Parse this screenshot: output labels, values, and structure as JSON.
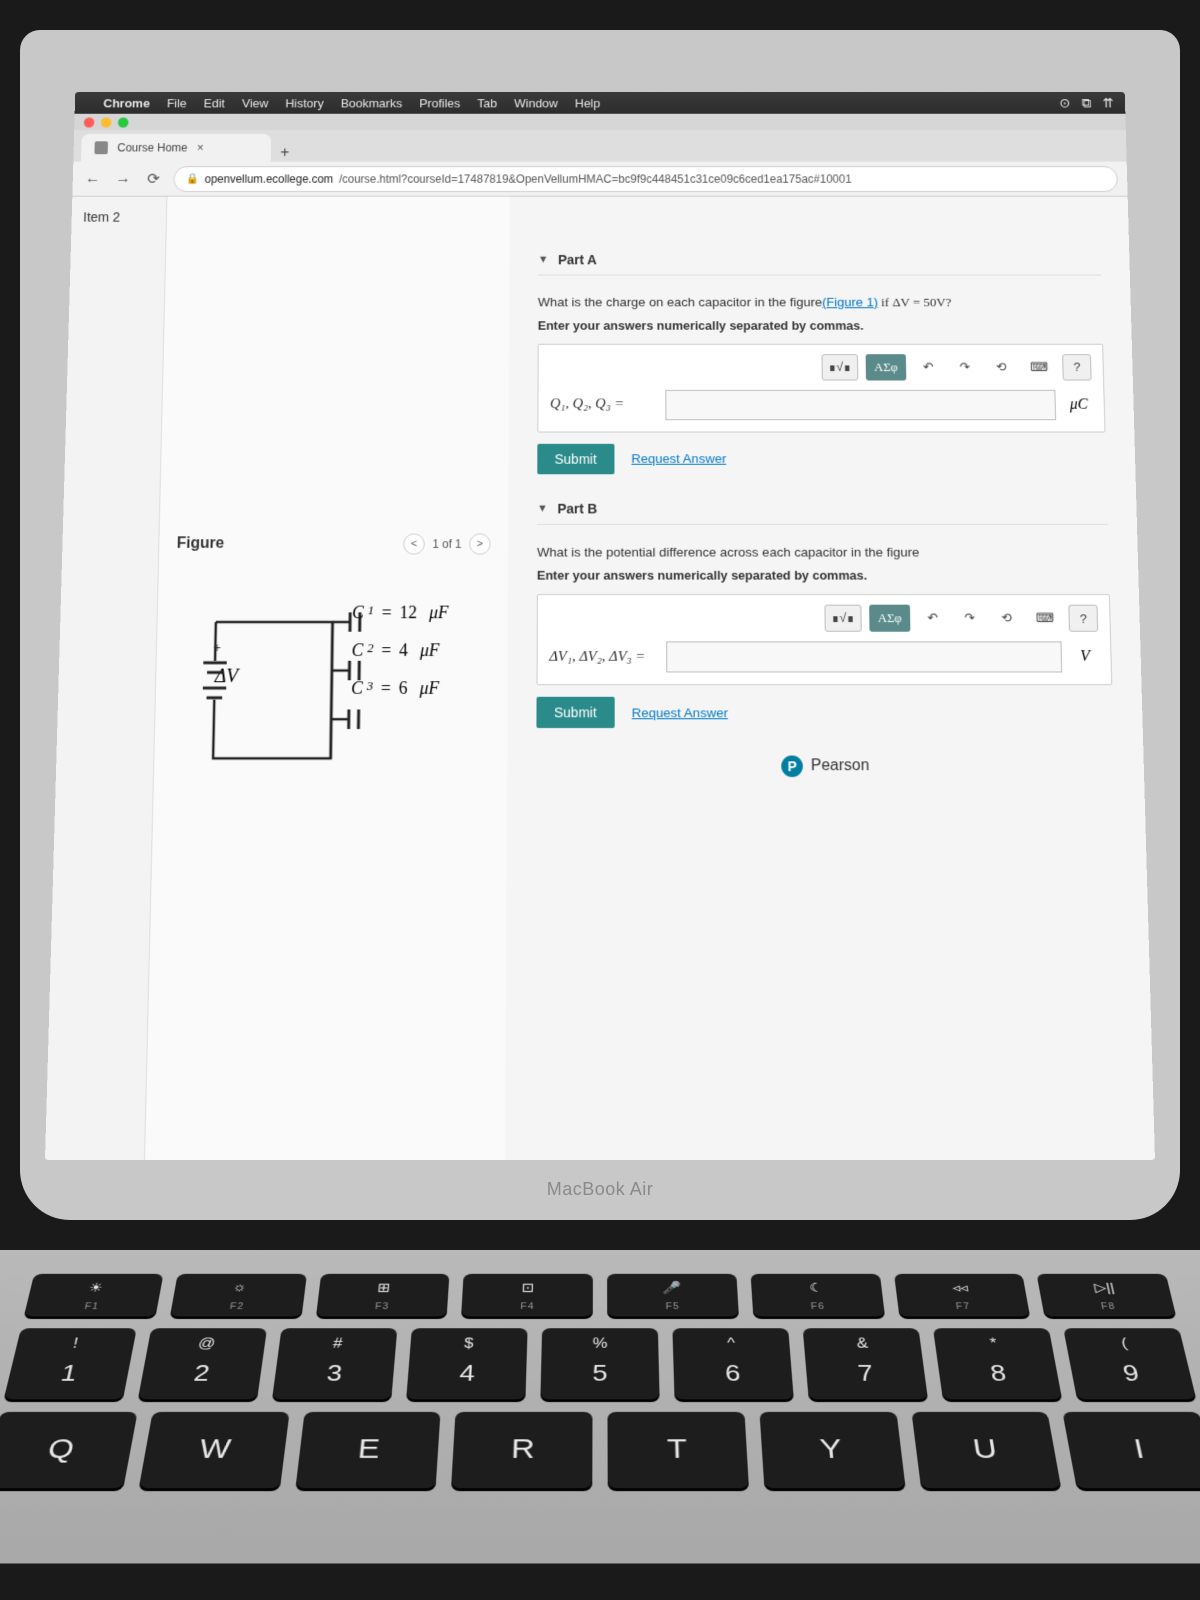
{
  "menubar": {
    "apple": "",
    "app": "Chrome",
    "items": [
      "File",
      "Edit",
      "View",
      "History",
      "Bookmarks",
      "Profiles",
      "Tab",
      "Window",
      "Help"
    ],
    "right_icons": [
      "⊙",
      "⧉",
      "⇈"
    ]
  },
  "tab": {
    "title": "Course Home",
    "close": "×",
    "new": "+"
  },
  "nav": {
    "back": "←",
    "fwd": "→",
    "reload": "⟳",
    "lock": "🔒"
  },
  "url": {
    "domain": "openvellum.ecollege.com",
    "path": "/course.html?courseId=17487819&OpenVellumHMAC=bc9f9c448451c31ce09c6ced1ea175ac#10001"
  },
  "sidebar": {
    "item": "Item 2"
  },
  "figure": {
    "title": "Figure",
    "counter": "1 of 1",
    "deltaV": "ΔV",
    "plus": "+",
    "minus": "−",
    "caps": [
      {
        "name": "C",
        "sub": "1",
        "val": "12",
        "unit": "μF"
      },
      {
        "name": "C",
        "sub": "2",
        "val": "4",
        "unit": "μF"
      },
      {
        "name": "C",
        "sub": "3",
        "val": "6",
        "unit": "μF"
      }
    ]
  },
  "partA": {
    "title": "Part A",
    "prompt_pre": "What is the charge on each capacitor in the figure",
    "link": "(Figure 1)",
    "prompt_post": " if ΔV = 50V?",
    "hint": "Enter your answers numerically separated by commas.",
    "input_label": "Q₁, Q₂, Q₃ =",
    "unit": "μC",
    "greek": "ΑΣφ",
    "undo": "↶",
    "redo": "↷",
    "reset": "⟲",
    "kbd": "⌨",
    "help": "?",
    "submit": "Submit",
    "request": "Request Answer"
  },
  "partB": {
    "title": "Part B",
    "prompt": "What is the potential difference across each capacitor in the figure",
    "hint": "Enter your answers numerically separated by commas.",
    "input_label": "ΔV₁, ΔV₂, ΔV₃ =",
    "unit": "V",
    "greek": "ΑΣφ",
    "undo": "↶",
    "redo": "↷",
    "reset": "⟲",
    "kbd": "⌨",
    "help": "?",
    "submit": "Submit",
    "request": "Request Answer"
  },
  "pearson": {
    "logo": "P",
    "name": "Pearson"
  },
  "macbook": "MacBook Air",
  "keyboard": {
    "fn": [
      {
        "icon": "☀",
        "label": "F1"
      },
      {
        "icon": "☼",
        "label": "F2"
      },
      {
        "icon": "⊞",
        "label": "F3"
      },
      {
        "icon": "⊡",
        "label": "F4"
      },
      {
        "icon": "🎤",
        "label": "F5"
      },
      {
        "icon": "☾",
        "label": "F6"
      },
      {
        "icon": "◃◃",
        "label": "F7"
      },
      {
        "icon": "▷||",
        "label": "F8"
      }
    ],
    "num": [
      {
        "sym": "!",
        "num": "1"
      },
      {
        "sym": "@",
        "num": "2"
      },
      {
        "sym": "#",
        "num": "3"
      },
      {
        "sym": "$",
        "num": "4"
      },
      {
        "sym": "%",
        "num": "5"
      },
      {
        "sym": "^",
        "num": "6"
      },
      {
        "sym": "&",
        "num": "7"
      },
      {
        "sym": "*",
        "num": "8"
      },
      {
        "sym": "(",
        "num": "9"
      }
    ],
    "letters": [
      "Q",
      "W",
      "E",
      "R",
      "T",
      "Y",
      "U",
      "I"
    ]
  }
}
